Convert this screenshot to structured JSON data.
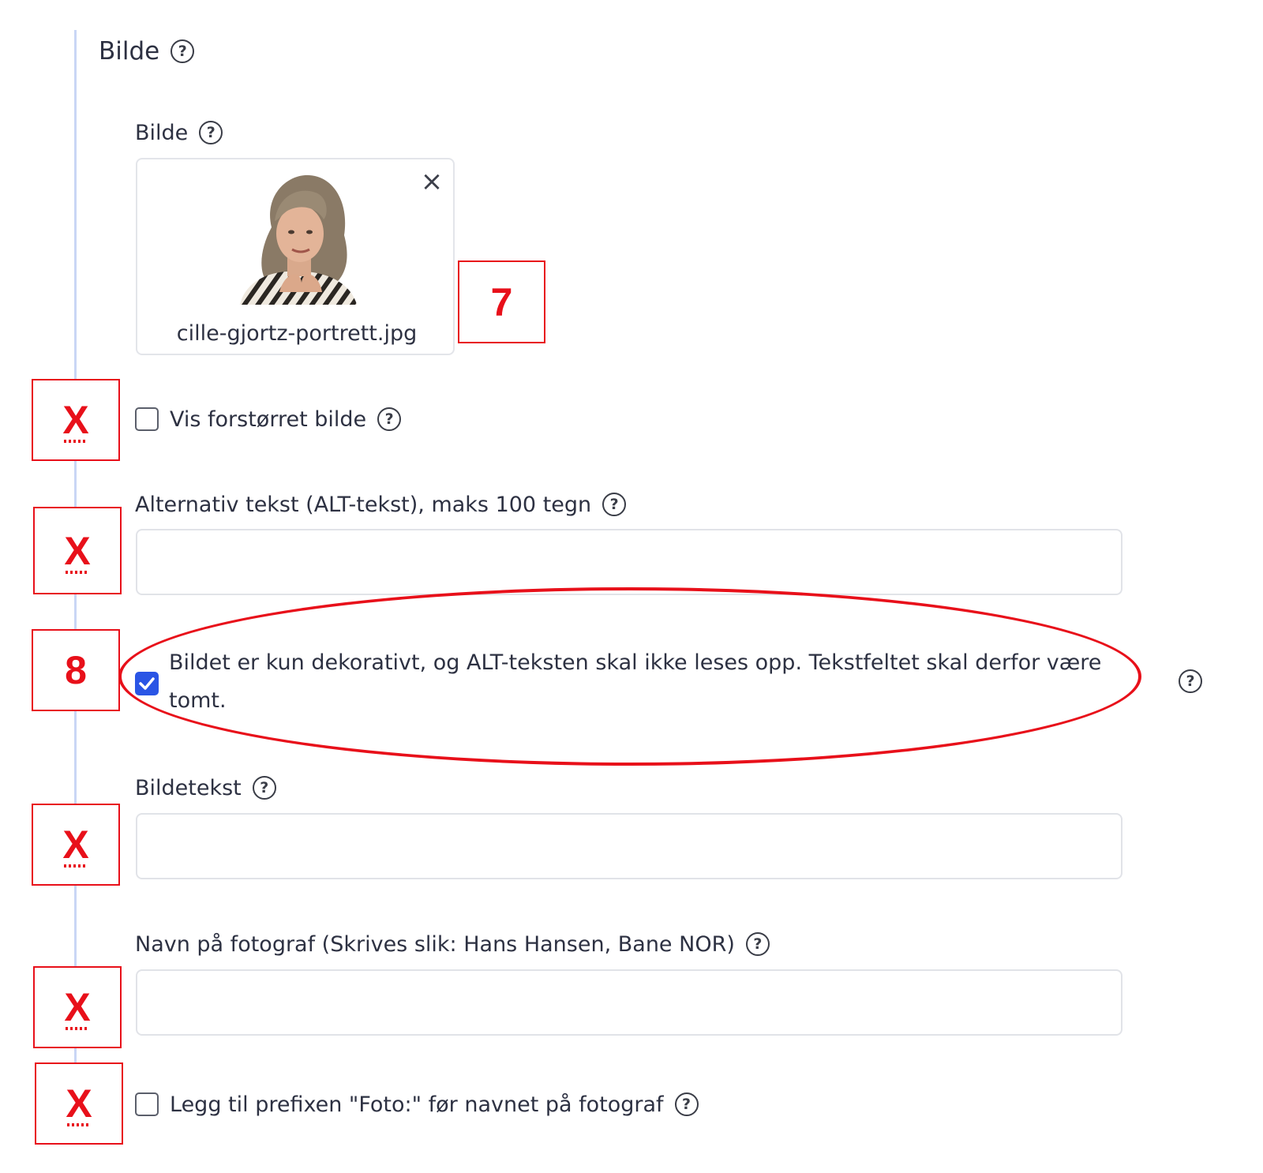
{
  "section": {
    "title": "Bilde"
  },
  "image_field": {
    "label": "Bilde",
    "filename": "cille-gjortz-portrett.jpg"
  },
  "enlarged_option": {
    "label": "Vis forstørret bilde",
    "checked": false
  },
  "alt_text": {
    "label": "Alternativ tekst (ALT-tekst), maks 100 tegn",
    "value": ""
  },
  "decorative_option": {
    "label": "Bildet er kun dekorativt, og ALT-teksten skal ikke leses opp. Tekstfeltet skal derfor være tomt.",
    "checked": true
  },
  "caption": {
    "label": "Bildetekst",
    "value": ""
  },
  "photographer": {
    "label": "Navn på fotograf (Skrives slik: Hans Hansen, Bane NOR)",
    "value": ""
  },
  "prefix_option": {
    "label": "Legg til prefixen \"Foto:\" før navnet på fotograf",
    "checked": false
  },
  "annotations": {
    "image_marker": "7",
    "decorative_marker": "8",
    "x_mark": "X"
  },
  "colors": {
    "annotation_red": "#e8101a",
    "checkbox_blue": "#2a55e5",
    "guide_line": "#c9d6f5"
  }
}
